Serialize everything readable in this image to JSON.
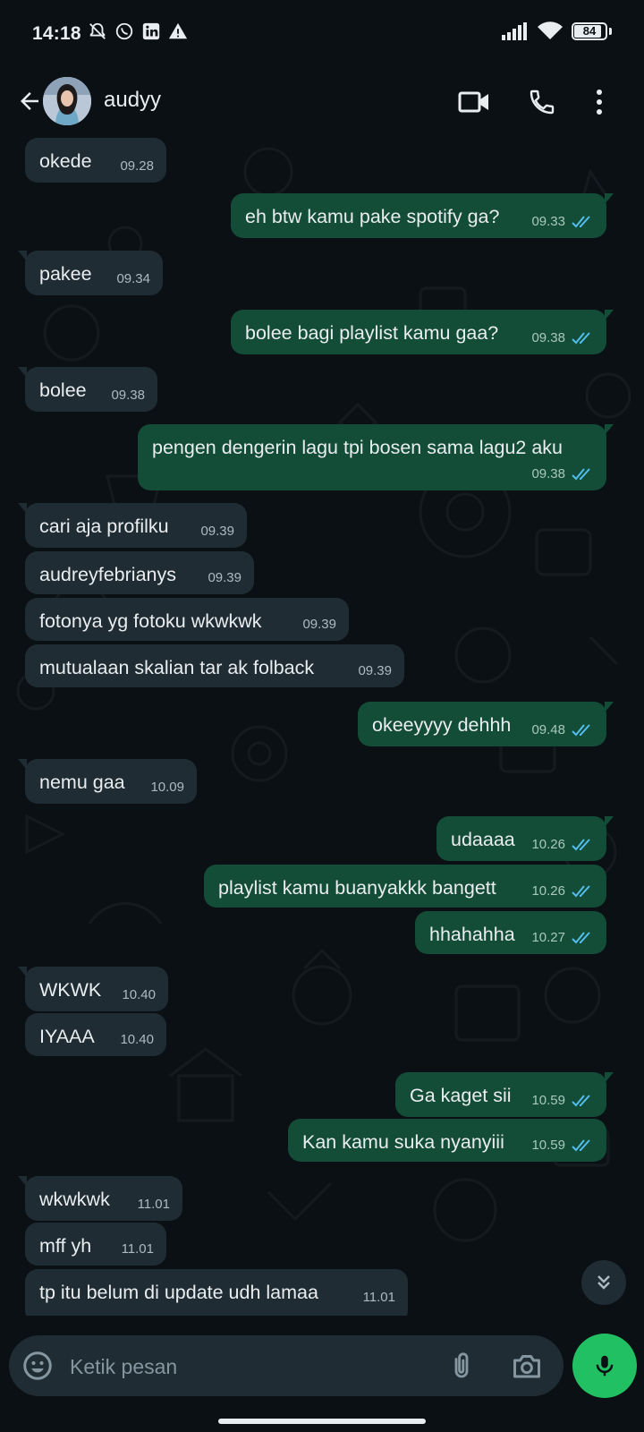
{
  "status_bar": {
    "time": "14:18",
    "battery": "84",
    "left_icons": [
      "bell-off-icon",
      "whatsapp-icon",
      "linkedin-icon",
      "warning-icon"
    ],
    "right_icons": [
      "signal-icon",
      "wifi-icon",
      "battery-icon"
    ]
  },
  "header": {
    "contact_name": "audyy",
    "icons": [
      "back-arrow-icon",
      "video-call-icon",
      "voice-call-icon",
      "more-options-icon"
    ]
  },
  "messages": [
    {
      "dir": "in",
      "text": "okede",
      "time": "09.28"
    },
    {
      "dir": "out",
      "text": "eh btw kamu pake spotify ga?",
      "time": "09.33"
    },
    {
      "dir": "in",
      "text": "pakee",
      "time": "09.34"
    },
    {
      "dir": "out",
      "text": "bolee bagi playlist kamu gaa?",
      "time": "09.38"
    },
    {
      "dir": "in",
      "text": "bolee",
      "time": "09.38"
    },
    {
      "dir": "out",
      "text": "pengen dengerin lagu tpi bosen sama lagu2 aku",
      "time": "09.38"
    },
    {
      "dir": "in",
      "text": "cari aja profilku",
      "time": "09.39"
    },
    {
      "dir": "in",
      "text": "audreyfebrianys",
      "time": "09.39"
    },
    {
      "dir": "in",
      "text": "fotonya yg fotoku wkwkwk",
      "time": "09.39"
    },
    {
      "dir": "in",
      "text": "mutualaan skalian tar ak folback",
      "time": "09.39"
    },
    {
      "dir": "out",
      "text": "okeeyyyy dehhh",
      "time": "09.48"
    },
    {
      "dir": "in",
      "text": "nemu gaa",
      "time": "10.09"
    },
    {
      "dir": "out",
      "text": "udaaaa",
      "time": "10.26"
    },
    {
      "dir": "out",
      "text": "playlist kamu buanyakkk bangett",
      "time": "10.26"
    },
    {
      "dir": "out",
      "text": "hhahahha",
      "time": "10.27"
    },
    {
      "dir": "in",
      "text": "WKWK",
      "time": "10.40"
    },
    {
      "dir": "in",
      "text": "IYAAA",
      "time": "10.40"
    },
    {
      "dir": "out",
      "text": "Ga kaget sii",
      "time": "10.59"
    },
    {
      "dir": "out",
      "text": "Kan kamu suka nyanyiii",
      "time": "10.59"
    },
    {
      "dir": "in",
      "text": "wkwkwk",
      "time": "11.01"
    },
    {
      "dir": "in",
      "text": "mff yh",
      "time": "11.01"
    },
    {
      "dir": "in",
      "text": "tp itu belum di update udh lamaa",
      "time": "11.01"
    }
  ],
  "composer": {
    "placeholder": "Ketik pesan",
    "icons": [
      "emoji-icon",
      "attach-icon",
      "camera-icon",
      "mic-icon"
    ]
  },
  "colors": {
    "background": "#0b1014",
    "incoming_bubble": "#1f2c33",
    "outgoing_bubble": "#134d37",
    "read_ticks": "#53bdeb",
    "mic_button": "#21c063"
  }
}
